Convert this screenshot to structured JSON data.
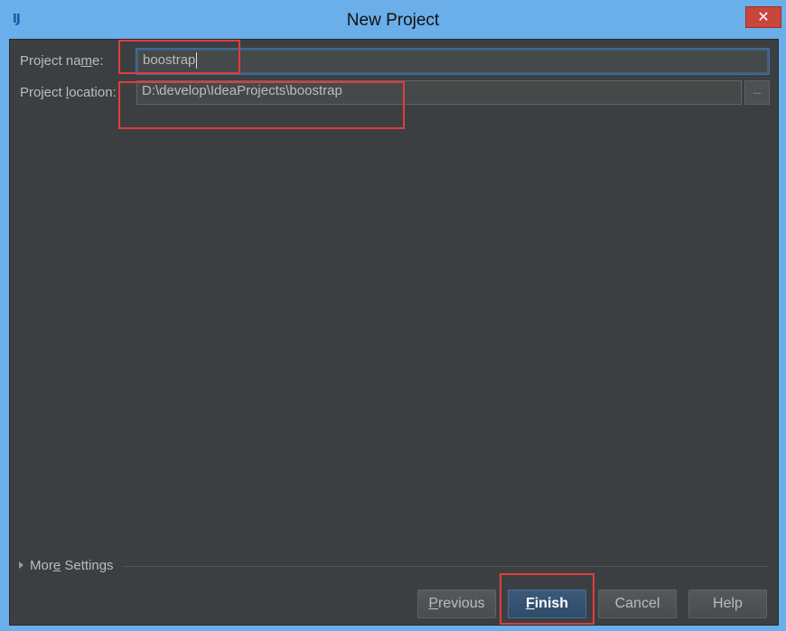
{
  "window": {
    "title": "New Project",
    "close_glyph": "✕",
    "app_icon": "intellij-idea-icon",
    "app_icon_glyph": "IJ"
  },
  "form": {
    "project_name_label_pre": "Project na",
    "project_name_label_mnemonic": "m",
    "project_name_label_post": "e:",
    "project_name_value": "boostrap",
    "project_location_label_pre": "Project ",
    "project_location_label_mnemonic": "l",
    "project_location_label_post": "ocation:",
    "project_location_value": "D:\\develop\\IdeaProjects\\boostrap",
    "browse_label": "..."
  },
  "more_settings": {
    "label_pre": "Mor",
    "label_mnemonic": "e",
    "label_post": " Settings"
  },
  "buttons": {
    "previous_mnemonic": "P",
    "previous_rest": "revious",
    "finish_mnemonic": "F",
    "finish_rest": "inish",
    "cancel": "Cancel",
    "help": "Help"
  },
  "colors": {
    "dialog_bg": "#3c3f41",
    "title_bar": "#6aaeea",
    "annotation_red": "#e23c3c",
    "primary_button": "#2f4b68"
  }
}
